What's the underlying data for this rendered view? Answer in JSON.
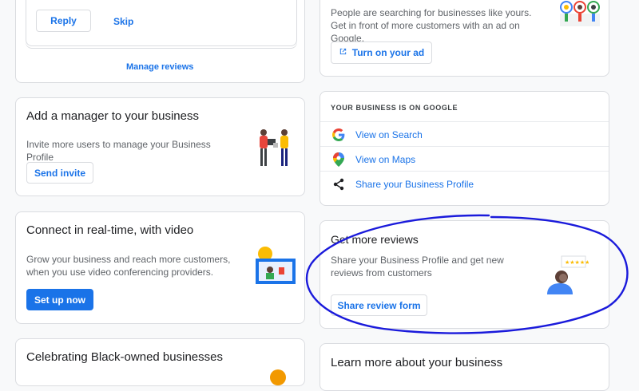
{
  "left": {
    "reviews_card": {
      "reply_label": "Reply",
      "skip_label": "Skip",
      "manage_label": "Manage reviews"
    },
    "manager_card": {
      "title": "Add a manager to your business",
      "description": "Invite more users to manage your Business Profile",
      "button_label": "Send invite"
    },
    "video_card": {
      "title": "Connect in real-time, with video",
      "description": "Grow your business and reach more customers, when you use video conferencing providers.",
      "button_label": "Set up now"
    },
    "black_owned_card": {
      "title": "Celebrating Black-owned businesses"
    }
  },
  "right": {
    "ad_card": {
      "description": "People are searching for businesses like yours. Get in front of more customers with an ad on Google.",
      "button_label": "Turn on your ad"
    },
    "on_google_card": {
      "heading": "YOUR BUSINESS IS ON GOOGLE",
      "items": [
        {
          "label": "View on Search",
          "icon": "google-g-icon"
        },
        {
          "label": "View on Maps",
          "icon": "maps-pin-icon"
        },
        {
          "label": "Share your Business Profile",
          "icon": "share-icon"
        }
      ]
    },
    "reviews_card": {
      "title": "Get more reviews",
      "description": "Share your Business Profile and get new reviews from customers",
      "button_label": "Share review form"
    },
    "learn_card": {
      "title": "Learn more about your business"
    }
  },
  "annotation": {
    "color": "#1a1adb"
  }
}
